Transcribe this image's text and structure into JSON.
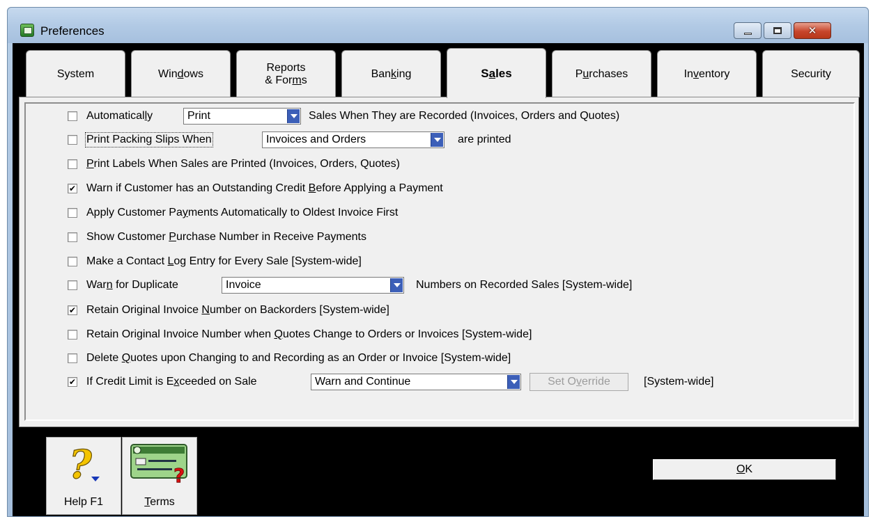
{
  "window": {
    "title": "Preferences",
    "minimize": "minimize",
    "maximize": "maximize",
    "close": "✕"
  },
  "tabs": [
    {
      "pre": "System",
      "accel": "",
      "post": ""
    },
    {
      "pre": "Win",
      "accel": "d",
      "post": "ows"
    },
    {
      "pre": "Reports\n& For",
      "accel": "m",
      "post": "s"
    },
    {
      "pre": "Ban",
      "accel": "k",
      "post": "ing"
    },
    {
      "pre": "S",
      "accel": "a",
      "post": "les"
    },
    {
      "pre": "P",
      "accel": "u",
      "post": "rchases"
    },
    {
      "pre": "In",
      "accel": "v",
      "post": "entory"
    },
    {
      "pre": "Security",
      "accel": "",
      "post": ""
    }
  ],
  "active_tab": "Sales",
  "options": {
    "auto": {
      "checked": false,
      "pre": "Automatical",
      "accel": "l",
      "post": "y",
      "select": "Print",
      "tail": "Sales When They are Recorded (Invoices, Orders and Quotes)"
    },
    "packing": {
      "checked": false,
      "label": "Print Packing Slips When",
      "select": "Invoices and Orders",
      "tail": "are printed"
    },
    "labels": {
      "checked": false,
      "accel": "P",
      "post": "rint Labels When Sales are Printed (Invoices, Orders, Quotes)"
    },
    "warn_credit": {
      "checked": true,
      "pre": "Warn if Customer has an Outstanding Credit ",
      "accel": "B",
      "post": "efore Applying a Payment"
    },
    "apply_payments": {
      "checked": false,
      "pre": "Apply Customer Pa",
      "accel": "y",
      "post": "ments Automatically to Oldest Invoice First"
    },
    "show_po": {
      "checked": false,
      "pre": "Show Customer ",
      "accel": "P",
      "post": "urchase Number in Receive Payments"
    },
    "contact_log": {
      "checked": false,
      "pre": "Make a Contact ",
      "accel": "L",
      "post": "og Entry for Every Sale [System-wide]"
    },
    "duplicate": {
      "checked": false,
      "pre": "War",
      "accel": "n",
      "post": " for Duplicate",
      "select": "Invoice",
      "tail": "Numbers on Recorded Sales [System-wide]"
    },
    "retain_backorders": {
      "checked": true,
      "pre": "Retain Original Invoice ",
      "accel": "N",
      "post": "umber on Backorders [System-wide]"
    },
    "retain_quotes": {
      "checked": false,
      "pre": "Retain Original Invoice Number when ",
      "accel": "Q",
      "post": "uotes Change to Orders or Invoices [System-wide]"
    },
    "delete_quotes": {
      "checked": false,
      "pre": "Delete ",
      "accel": "Q",
      "post": "uotes upon Changing to and Recording as an Order or Invoice [System-wide]"
    },
    "credit_limit": {
      "checked": true,
      "pre": "If Credit Limit is E",
      "accel": "x",
      "post": "ceeded on Sale",
      "select": "Warn and Continue",
      "override_pre": "Set O",
      "override_accel": "v",
      "override_post": "erride",
      "tail": "[System-wide]"
    }
  },
  "check_mark": "✔",
  "toolbar": {
    "help": {
      "label": "Help F1",
      "icon": "help-question-icon"
    },
    "terms": {
      "accel": "T",
      "post": "erms",
      "icon": "terms-card-icon"
    }
  },
  "ok": {
    "accel": "O",
    "post": "K"
  }
}
